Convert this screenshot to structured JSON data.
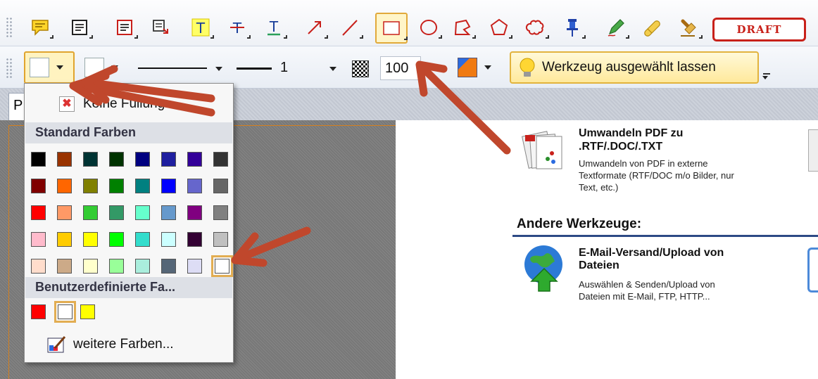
{
  "toolbar1": {
    "draft_label": "DRAFT",
    "tools": [
      "comment-icon",
      "note-icon",
      "textbox-icon",
      "replace-text-icon",
      "highlight-text-icon",
      "strikeout-text-icon",
      "underline-text-icon",
      "arrow-icon",
      "line-icon",
      "rectangle-icon",
      "ellipse-icon",
      "polyline-icon",
      "polygon-icon",
      "cloud-icon",
      "pin-icon",
      "pencil-icon",
      "eraser-icon",
      "stamp-icon"
    ]
  },
  "toolbar2": {
    "line_width_value": "1",
    "opacity_value": "100",
    "keep_tool_label": "Werkzeug ausgewählt lassen",
    "accent_fill_color": "#ffffff",
    "accent_line_color": "#f07a12"
  },
  "tabs": {
    "first_tab_initial": "P"
  },
  "color_dropdown": {
    "no_fill_label": "Keine Füllung",
    "standard_header": "Standard Farben",
    "custom_header": "Benutzerdefinierte Fa...",
    "more_colors_label": "weitere Farben...",
    "standard_colors": [
      [
        "#000000",
        "#993300",
        "#003333",
        "#003300",
        "#000080",
        "#1f1f9f",
        "#330099",
        "#333333"
      ],
      [
        "#800000",
        "#ff6600",
        "#808000",
        "#008000",
        "#008080",
        "#0000ff",
        "#6666cc",
        "#666666"
      ],
      [
        "#ff0000",
        "#ff9966",
        "#33cc33",
        "#339966",
        "#66ffcc",
        "#6699cc",
        "#800080",
        "#808080"
      ],
      [
        "#ffbbcc",
        "#ffcc00",
        "#ffff00",
        "#00ff00",
        "#33ddcc",
        "#ccffff",
        "#330033",
        "#c0c0c0"
      ],
      [
        "#ffddcc",
        "#ccaa88",
        "#ffffcc",
        "#99ff99",
        "#aaeedd",
        "#556677",
        "#ddddf5",
        "#ffffff"
      ]
    ],
    "custom_colors": [
      "#ff0000",
      "#ffffff",
      "#ffff00"
    ]
  },
  "content": {
    "convert_title_line1": "Umwandeln PDF zu",
    "convert_title_line2": ".RTF/.DOC/.TXT",
    "convert_desc_line1": "Umwandeln von PDF in externe",
    "convert_desc_line2": "Textformate (RTF/DOC m/o Bilder, nur",
    "convert_desc_line3": "Text, etc.)",
    "section_heading": "Andere Werkzeuge:",
    "email_title_line1": "E-Mail-Versand/Upload von",
    "email_title_line2": "Dateien",
    "email_desc_line1": "Auswählen & Senden/Upload von",
    "email_desc_line2": "Dateien mit E-Mail, FTP, HTTP..."
  },
  "annotation_arrow_color": "#c0472c"
}
